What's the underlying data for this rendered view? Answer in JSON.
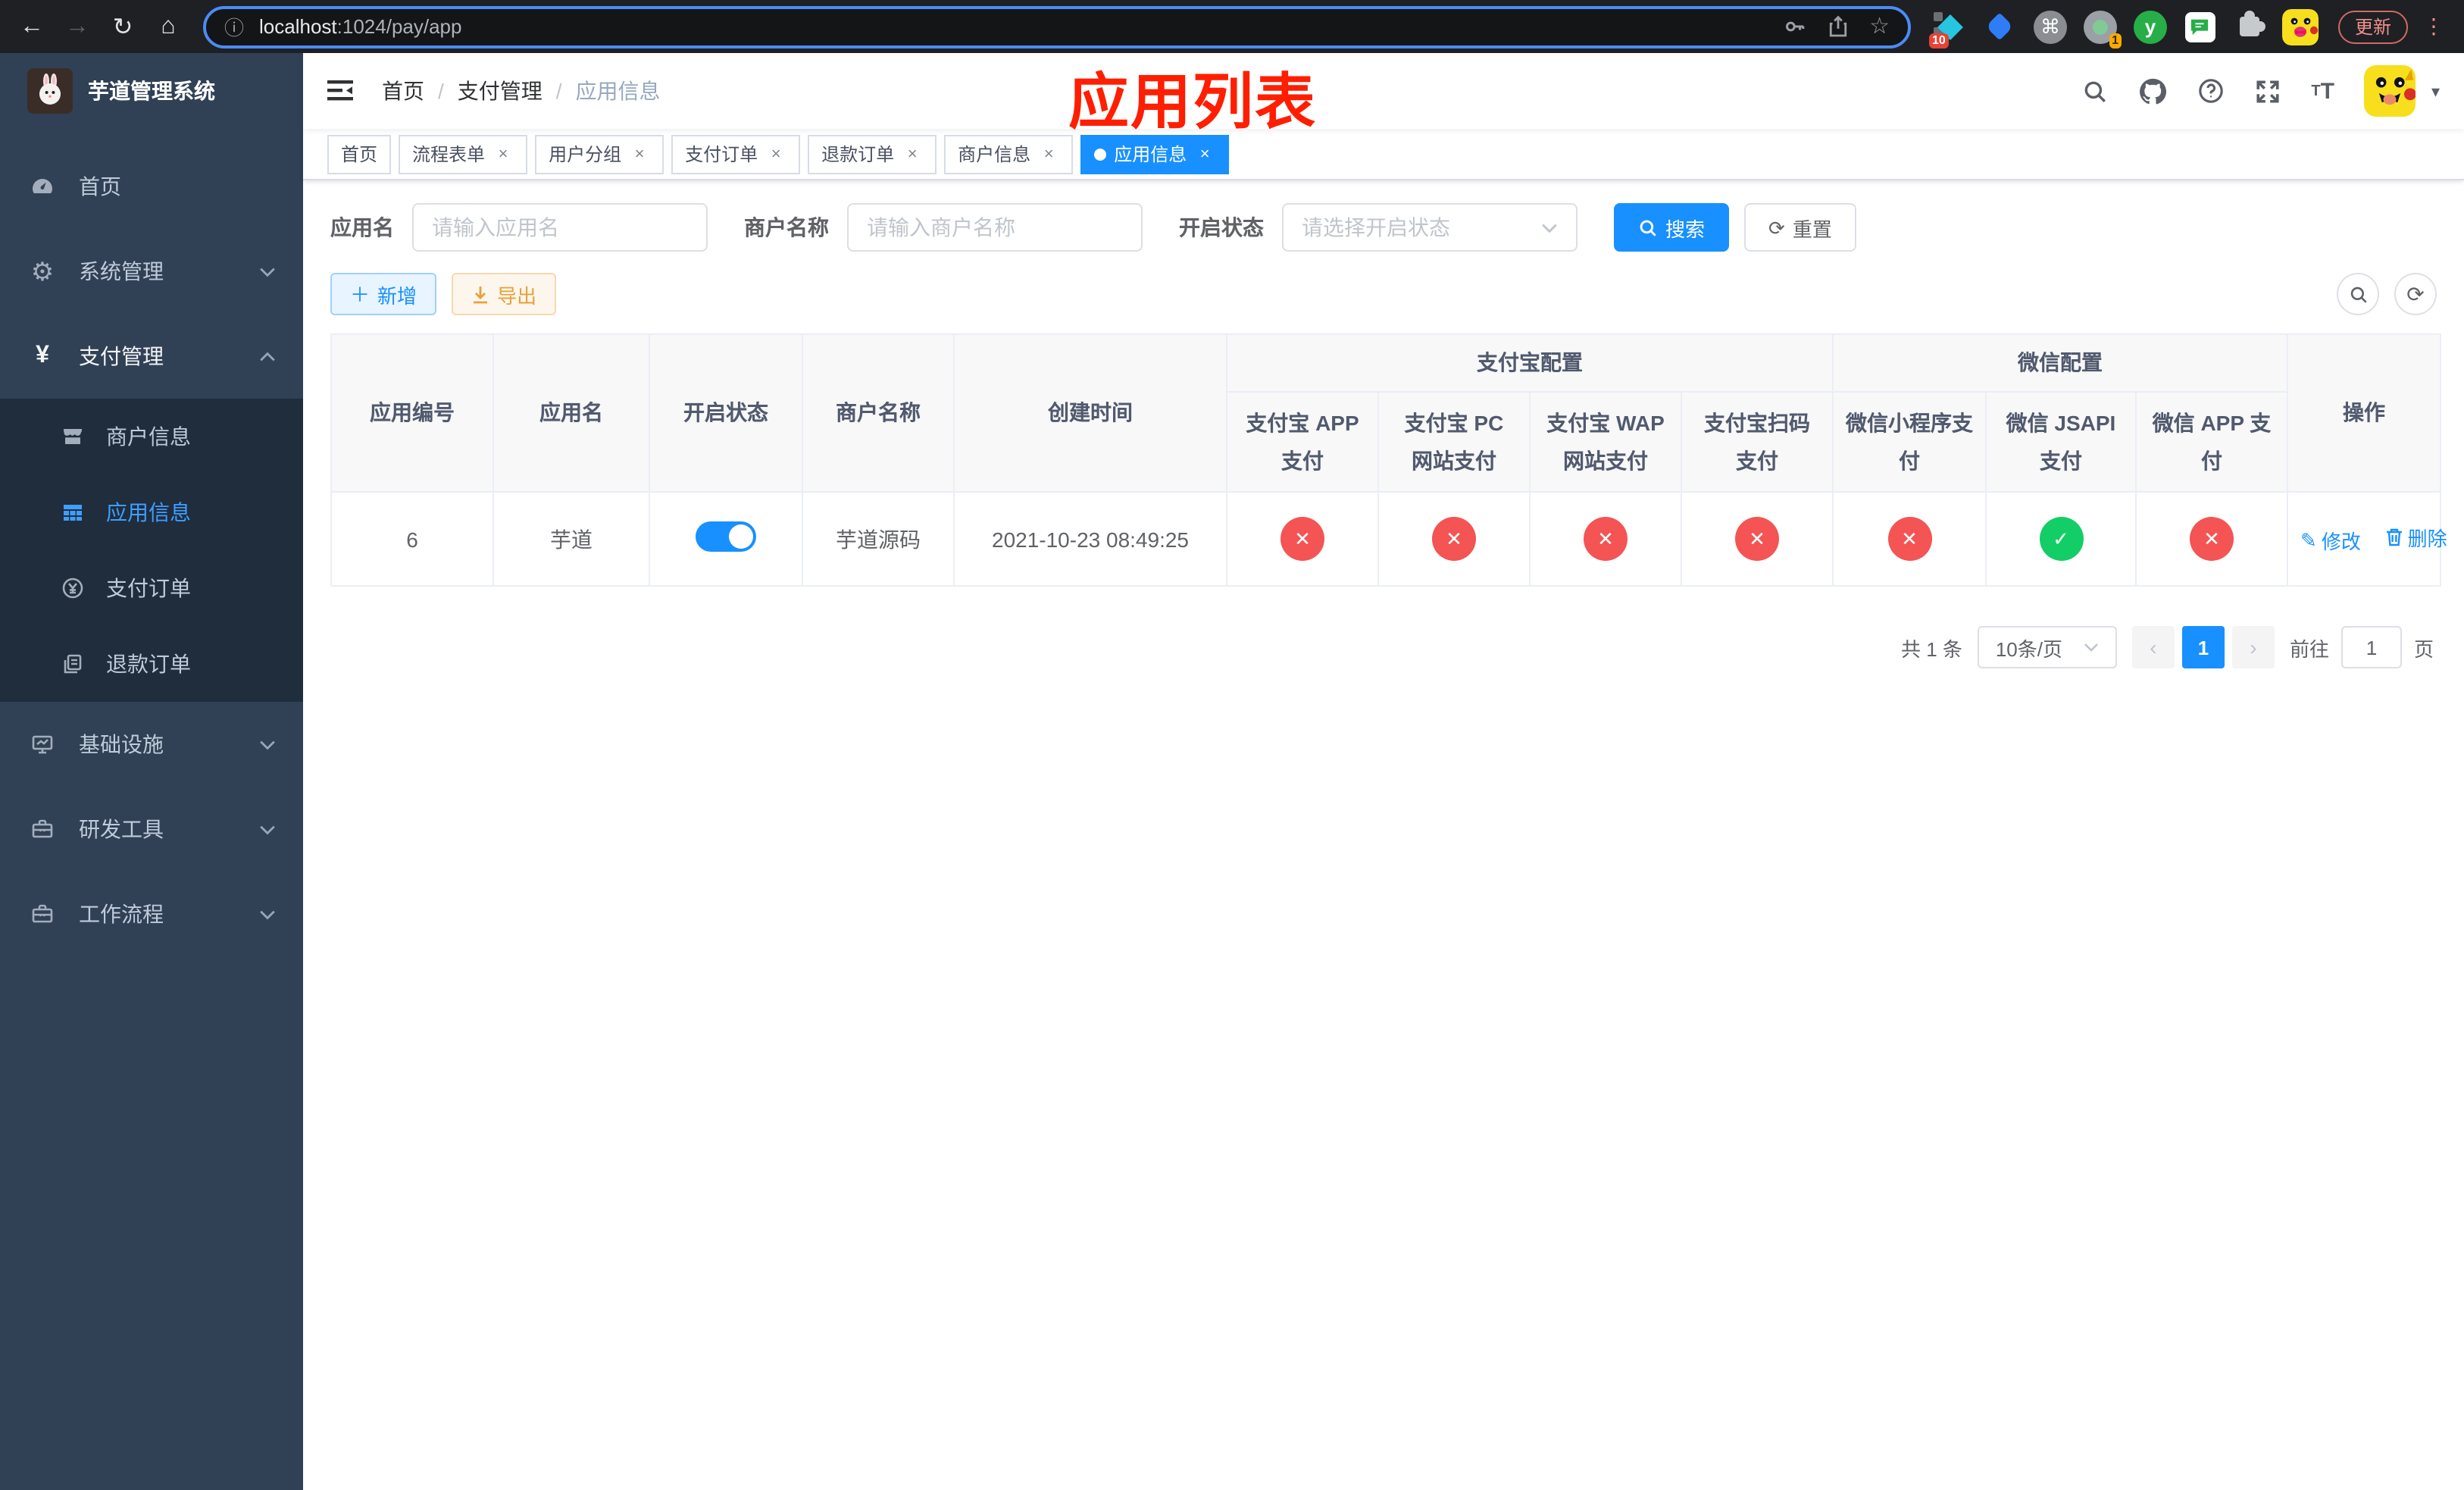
{
  "browser": {
    "url_host": "localhost",
    "url_path": ":1024/pay/app",
    "update_label": "更新",
    "ext_badge_pin": "10",
    "ext_badge_rec": "1",
    "ext_y_letter": "y"
  },
  "icons": {
    "back": "←",
    "forward": "→",
    "reload": "↻",
    "home": "⌂",
    "info": "ⓘ",
    "star": "☆",
    "cmd": "⌘",
    "dots": "⋮",
    "gear": "⚙",
    "yen": "¥",
    "caret_down": "▾",
    "close": "×",
    "plus": "＋",
    "refresh": "⟳",
    "edit": "✎",
    "prev": "‹",
    "next": "›",
    "check": "✓",
    "cross": "✕"
  },
  "sidebar": {
    "logo_title": "芋道管理系统",
    "menu": [
      {
        "label": "首页"
      },
      {
        "label": "系统管理"
      },
      {
        "label": "支付管理"
      },
      {
        "label": "商户信息"
      },
      {
        "label": "应用信息"
      },
      {
        "label": "支付订单"
      },
      {
        "label": "退款订单"
      },
      {
        "label": "基础设施"
      },
      {
        "label": "研发工具"
      },
      {
        "label": "工作流程"
      }
    ]
  },
  "navbar": {
    "breadcrumb": [
      {
        "label": "首页"
      },
      {
        "label": "支付管理"
      },
      {
        "label": "应用信息"
      }
    ]
  },
  "annotation": {
    "text": "应用列表",
    "color": "#ff1e00"
  },
  "tabs": [
    {
      "label": "首页"
    },
    {
      "label": "流程表单"
    },
    {
      "label": "用户分组"
    },
    {
      "label": "支付订单"
    },
    {
      "label": "退款订单"
    },
    {
      "label": "商户信息"
    },
    {
      "label": "应用信息"
    }
  ],
  "search": {
    "app_name_label": "应用名",
    "app_name_placeholder": "请输入应用名",
    "merchant_label": "商户名称",
    "merchant_placeholder": "请输入商户名称",
    "status_label": "开启状态",
    "status_placeholder": "请选择开启状态",
    "search_label": "搜索",
    "reset_label": "重置"
  },
  "toolbar": {
    "add_label": "新增",
    "export_label": "导出"
  },
  "table": {
    "headers": {
      "id": "应用编号",
      "name": "应用名",
      "enabled": "开启状态",
      "merchant": "商户名称",
      "created": "创建时间",
      "alipay_group": "支付宝配置",
      "wechat_group": "微信配置",
      "alipay": [
        "支付宝 APP 支付",
        "支付宝 PC 网站支付",
        "支付宝 WAP 网站支付",
        "支付宝扫码支付"
      ],
      "wechat": [
        "微信小程序支付",
        "微信 JSAPI 支付",
        "微信 APP 支付"
      ],
      "actions": "操作"
    },
    "rows": [
      {
        "id": "6",
        "name": "芋道",
        "enabled": true,
        "merchant": "芋道源码",
        "created": "2021-10-23 08:49:25",
        "statuses": [
          "no",
          "no",
          "no",
          "no",
          "no",
          "yes",
          "no"
        ],
        "edit_label": "修改",
        "delete_label": "删除"
      }
    ]
  },
  "pagination": {
    "total": "共 1 条",
    "size": "10条/页",
    "page": "1",
    "goto_label": "前往",
    "goto_value": "1",
    "unit_label": "页"
  },
  "colors": {
    "primary": "#1890ff",
    "menu_active": "#409eff",
    "success": "#13ce66",
    "danger": "#f45454",
    "warning": "#e6a23c",
    "sidebar_bg": "#304156",
    "submenu_bg": "#1f2d3d",
    "annotation": "#ff1e00"
  }
}
